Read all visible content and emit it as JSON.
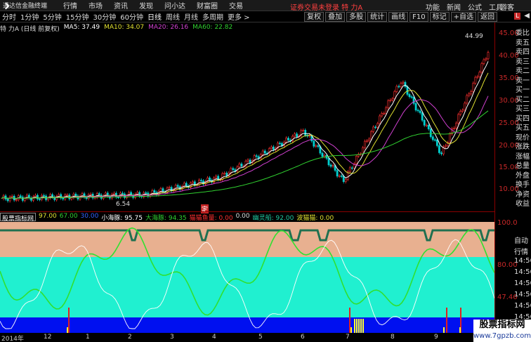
{
  "app": {
    "title": "通达信金融终端",
    "menu": [
      "行情",
      "市场",
      "资讯",
      "发现",
      "问小达",
      "财富圈",
      "交易"
    ],
    "status": "证券交易未登录  特 力A",
    "right_menu": [
      "功能",
      "新闻",
      "公式",
      "工具"
    ],
    "guest": "游客"
  },
  "periods": [
    "分时",
    "1分钟",
    "5分钟",
    "15分钟",
    "30分钟",
    "60分钟",
    "日线",
    "周线",
    "月线",
    "多周期",
    "更多 >"
  ],
  "active_period": "日线",
  "tools": [
    "复权",
    "叠加",
    "多股",
    "统计",
    "画线",
    "F10",
    "标记",
    "+自选",
    "返回"
  ],
  "window_controls": [
    "X",
    "◀"
  ],
  "info": {
    "stock": "特 力A (日线 前复权)",
    "ma5": "MA5: 37.49",
    "ma10": "MA10: 34.07",
    "ma20": "MA20: 26.16",
    "ma60": "MA60: 22.82"
  },
  "colors": {
    "ma5": "#ffffff",
    "ma10": "#e0e030",
    "ma20": "#d040d0",
    "ma60": "#30d030",
    "up": "#ff3030",
    "down": "#00d0d0",
    "axis": "#c82828"
  },
  "price_axis": [
    "45.00",
    "40.00",
    "35.00",
    "30.00",
    "25.00",
    "20.00",
    "15.00",
    "10.00"
  ],
  "annotations": {
    "high": "44.99",
    "low": "6.54",
    "marker": "定"
  },
  "order_panel": [
    "委比",
    "卖五",
    "卖四",
    "卖三",
    "卖二",
    "卖一",
    "买一",
    "买二",
    "买三",
    "买四",
    "买五",
    "现价",
    "涨跌",
    "涨幅",
    "总量",
    "外盘",
    "换手",
    "净资",
    "收益"
  ],
  "indicator": {
    "name": "股票指标网",
    "v1": "97.00",
    "v2": "67.00",
    "v3": "30.00",
    "xiaohaitun": "小海豚: 95.75",
    "dahaitun": "大海豚: 94.35",
    "maomao": "猫猫鱼量: 0.00",
    "v4": "0.00",
    "youlingchuan": "幽灵船: 92.00",
    "bomaomao": "波猫猫: 0.00"
  },
  "sub_axis": [
    "100.0",
    "80.00",
    "47.46",
    "20.00"
  ],
  "time_panel": [
    "自动",
    "行情",
    "14:56",
    "14:56",
    "14:56",
    "14:56",
    "14:56",
    "14:56",
    "14:56",
    "14:56"
  ],
  "dates": [
    "2014年",
    "12",
    "1",
    "2",
    "3",
    "4",
    "5",
    "6",
    "7",
    "8",
    "9",
    "10"
  ],
  "watermark": {
    "title": "股票指标网",
    "url": "www.7gpzb.com"
  }
}
